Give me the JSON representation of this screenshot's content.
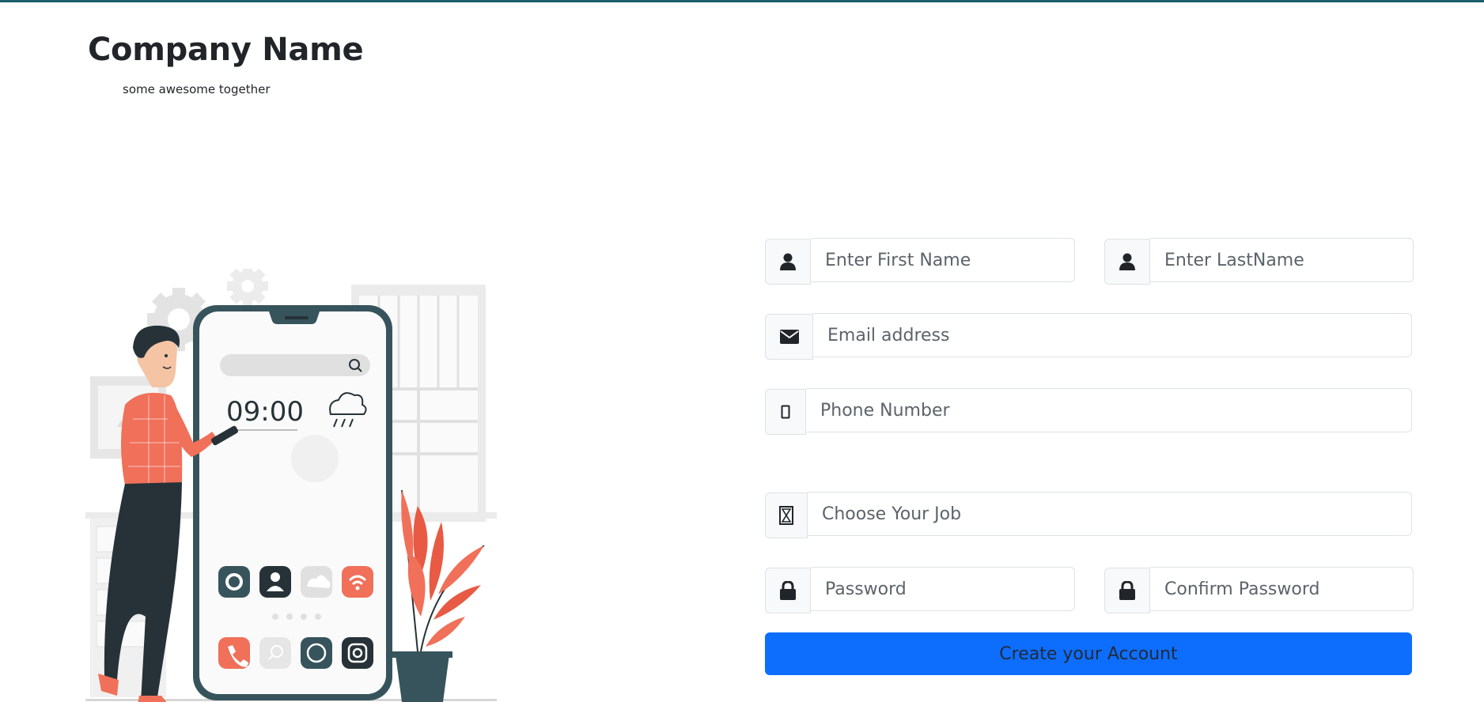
{
  "brand": {
    "title": "Company Name",
    "tagline": "some awesome together"
  },
  "illustration": {
    "phone_time": "09:00"
  },
  "form": {
    "first_name_placeholder": "Enter First Name",
    "last_name_placeholder": "Enter LastName",
    "email_placeholder": "Email address",
    "phone_placeholder": "Phone Number",
    "job_placeholder": "Choose Your Job",
    "password_placeholder": "Password",
    "confirm_password_placeholder": "Confirm Password",
    "submit_label": "Create your Account"
  },
  "icons": {
    "first_name": "user-icon",
    "last_name": "user-icon",
    "email": "envelope-icon",
    "phone": "mobile-icon",
    "job": "hourglass-icon",
    "password": "lock-icon",
    "confirm_password": "lock-icon"
  },
  "colors": {
    "accent": "#0d6efd",
    "top_bar": "#1d5e6b",
    "illustration_coral": "#f0705a",
    "illustration_dark": "#263238",
    "illustration_teal": "#37545c"
  }
}
